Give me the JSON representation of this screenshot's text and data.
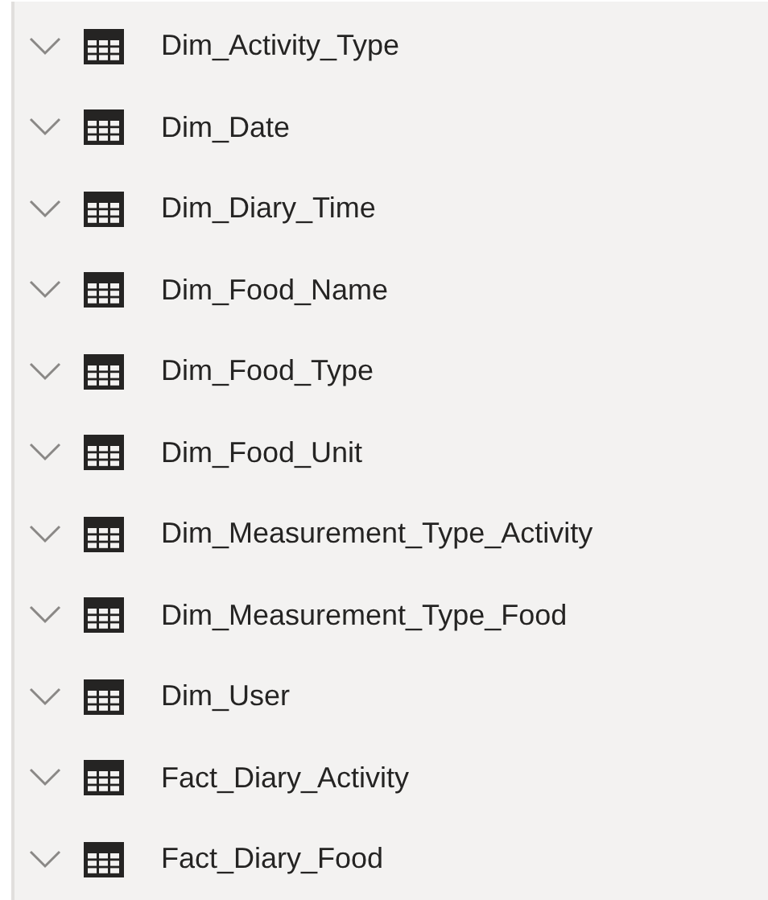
{
  "tables": [
    {
      "name": "Dim_Activity_Type"
    },
    {
      "name": "Dim_Date"
    },
    {
      "name": "Dim_Diary_Time"
    },
    {
      "name": "Dim_Food_Name"
    },
    {
      "name": "Dim_Food_Type"
    },
    {
      "name": "Dim_Food_Unit"
    },
    {
      "name": "Dim_Measurement_Type_Activity"
    },
    {
      "name": "Dim_Measurement_Type_Food"
    },
    {
      "name": "Dim_User"
    },
    {
      "name": "Fact_Diary_Activity"
    },
    {
      "name": "Fact_Diary_Food"
    }
  ]
}
